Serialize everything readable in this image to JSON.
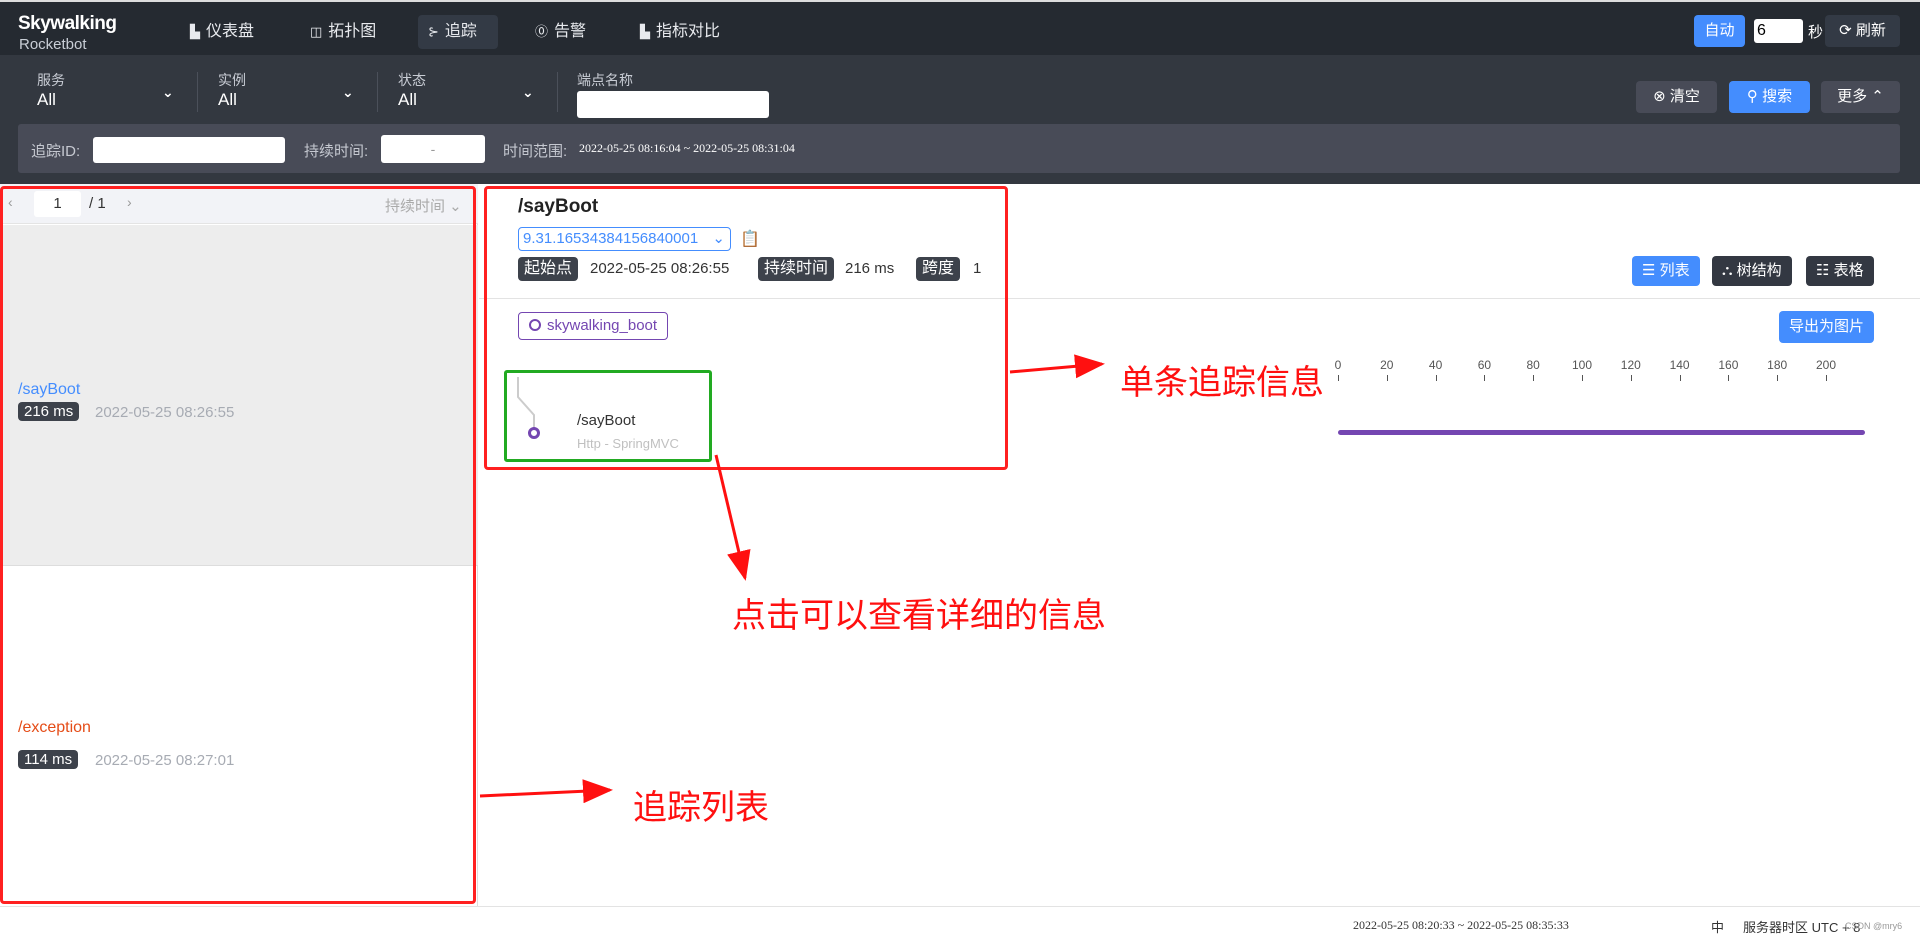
{
  "header": {
    "logo": "Skywalking",
    "logo_sub": "Rocketbot",
    "nav": [
      {
        "label": "仪表盘",
        "icon": "bar-chart-icon"
      },
      {
        "label": "拓扑图",
        "icon": "topology-icon"
      },
      {
        "label": "追踪",
        "icon": "trace-icon",
        "active": true
      },
      {
        "label": "告警",
        "icon": "alarm-icon"
      },
      {
        "label": "指标对比",
        "icon": "bar-chart-icon"
      }
    ],
    "auto_label": "自动",
    "interval_value": "6",
    "seconds_label": "秒",
    "refresh_label": "刷新"
  },
  "filters": {
    "service": {
      "label": "服务",
      "value": "All"
    },
    "instance": {
      "label": "实例",
      "value": "All"
    },
    "status": {
      "label": "状态",
      "value": "All"
    },
    "endpoint": {
      "label": "端点名称",
      "value": ""
    },
    "clear_label": "清空",
    "search_label": "搜索",
    "more_label": "更多",
    "trace_id_label": "追踪ID:",
    "trace_id_value": "",
    "duration_label": "持续时间:",
    "duration_value": "-",
    "time_range_label": "时间范围:",
    "time_range_value": "2022-05-25 08:16:04 ~ 2022-05-25 08:31:04"
  },
  "trace_list": {
    "page": "1",
    "total_pages": "/ 1",
    "sort_label": "持续时间",
    "items": [
      {
        "endpoint": "/sayBoot",
        "duration": "216 ms",
        "start": "2022-05-25 08:26:55",
        "selected": true,
        "color": "#448dfe"
      },
      {
        "endpoint": "/exception",
        "duration": "114 ms",
        "start": "2022-05-25 08:27:01",
        "color": "#e54c17"
      }
    ]
  },
  "detail": {
    "title": "/sayBoot",
    "trace_id": "9.31.16534384156840001",
    "start_label": "起始点",
    "start_value": "2022-05-25 08:26:55",
    "duration_label": "持续时间",
    "duration_value": "216 ms",
    "span_label": "跨度",
    "span_value": "1",
    "views": [
      {
        "label": "列表",
        "active": true
      },
      {
        "label": "树结构"
      },
      {
        "label": "表格"
      }
    ],
    "service_tag": "skywalking_boot",
    "export_label": "导出为图片",
    "axis_ticks": [
      "0",
      "20",
      "40",
      "60",
      "80",
      "100",
      "120",
      "140",
      "160",
      "180",
      "200"
    ],
    "spans": [
      {
        "name": "/sayBoot",
        "type": "Http - SpringMVC",
        "start_ms": 0,
        "duration_ms": 216
      }
    ],
    "span_color": "#7446b1"
  },
  "annotations": {
    "single": "单条追踪信息",
    "click": "点击可以查看详细的信息",
    "list": "追踪列表"
  },
  "footer": {
    "time_range": "2022-05-25 08:20:33 ~ 2022-05-25 08:35:33",
    "lang": "中",
    "timezone": "服务器时区 UTC + 8",
    "watermark": "CSDN @mry6"
  },
  "colors": {
    "primary": "#448dfe",
    "header_bg": "#252a31",
    "annotation": "#ff2020",
    "highlight": "#22aa22"
  }
}
